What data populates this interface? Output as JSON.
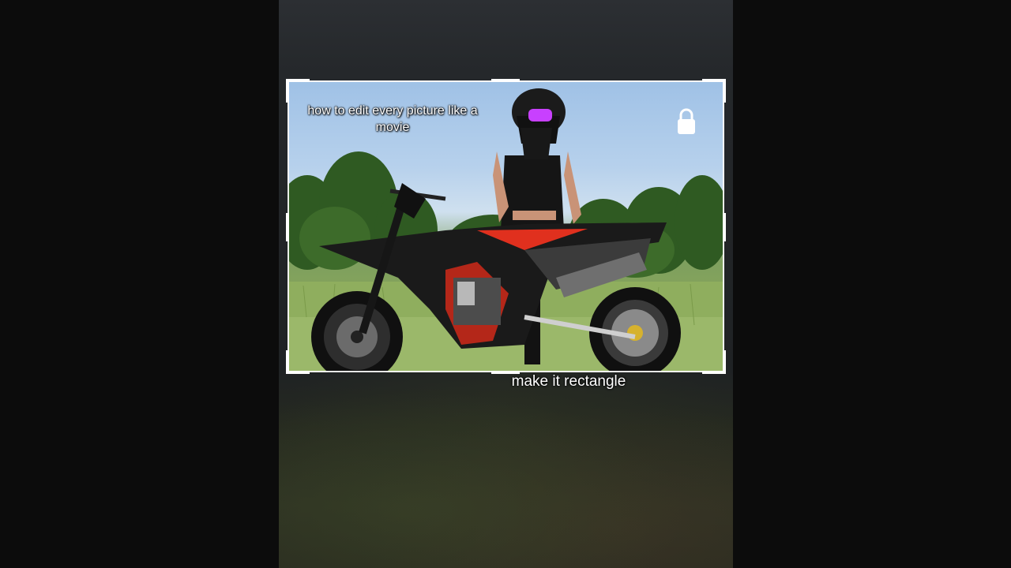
{
  "overlay": {
    "caption_top": "how to edit every picture like a movie",
    "caption_bottom": "make it rectangle"
  },
  "icons": {
    "lock": "lock-icon"
  },
  "colors": {
    "frame_border": "#ffffff",
    "background": "#0c0c0c",
    "accent_red": "#e0301e",
    "goggle_purple": "#c840ff"
  }
}
